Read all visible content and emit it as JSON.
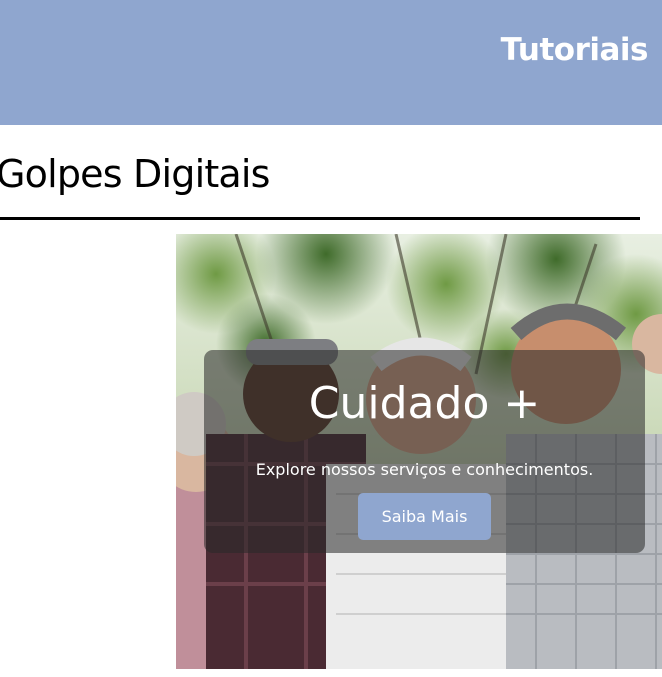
{
  "header": {
    "nav_link": "Tutoriais",
    "background_color": "#8fa6cf"
  },
  "page": {
    "title": "Golpes Digitais"
  },
  "hero": {
    "image": "photo of a group of smiling elderly people outdoors under trees",
    "title": "Cuidado +",
    "subtitle": "Explore nossos serviços e conhecimentos.",
    "button_label": "Saiba Mais",
    "button_color": "#8fa6cf"
  }
}
